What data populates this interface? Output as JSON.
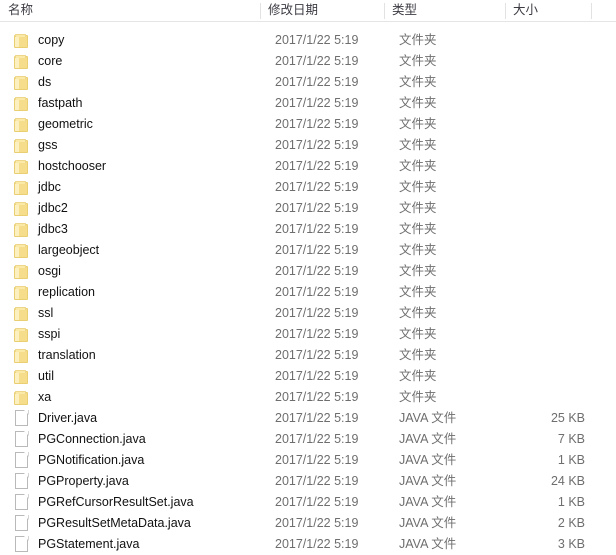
{
  "window": {
    "view": "details",
    "top_artifact": "··"
  },
  "colors": {
    "folder_icon": "#f6dd8c",
    "folder_icon_border": "#e9cf72",
    "file_icon_bg": "#ffffff",
    "file_icon_border": "#b9b9b9",
    "name_text": "#111111",
    "meta_text": "#6e6e6e",
    "header_text": "#3c3c44",
    "header_rule": "#e5e5e5",
    "column_divider": "#e2e2e2",
    "background": "#ffffff"
  },
  "columns": [
    {
      "key": "name",
      "label": "名称"
    },
    {
      "key": "date",
      "label": "修改日期"
    },
    {
      "key": "type",
      "label": "类型"
    },
    {
      "key": "size",
      "label": "大小"
    }
  ],
  "rows": [
    {
      "name": "copy",
      "date": "2017/1/22 5:19",
      "type": "文件夹",
      "size": "",
      "icon": "folder-icon"
    },
    {
      "name": "core",
      "date": "2017/1/22 5:19",
      "type": "文件夹",
      "size": "",
      "icon": "folder-icon"
    },
    {
      "name": "ds",
      "date": "2017/1/22 5:19",
      "type": "文件夹",
      "size": "",
      "icon": "folder-icon"
    },
    {
      "name": "fastpath",
      "date": "2017/1/22 5:19",
      "type": "文件夹",
      "size": "",
      "icon": "folder-icon"
    },
    {
      "name": "geometric",
      "date": "2017/1/22 5:19",
      "type": "文件夹",
      "size": "",
      "icon": "folder-icon"
    },
    {
      "name": "gss",
      "date": "2017/1/22 5:19",
      "type": "文件夹",
      "size": "",
      "icon": "folder-icon"
    },
    {
      "name": "hostchooser",
      "date": "2017/1/22 5:19",
      "type": "文件夹",
      "size": "",
      "icon": "folder-icon"
    },
    {
      "name": "jdbc",
      "date": "2017/1/22 5:19",
      "type": "文件夹",
      "size": "",
      "icon": "folder-icon"
    },
    {
      "name": "jdbc2",
      "date": "2017/1/22 5:19",
      "type": "文件夹",
      "size": "",
      "icon": "folder-icon"
    },
    {
      "name": "jdbc3",
      "date": "2017/1/22 5:19",
      "type": "文件夹",
      "size": "",
      "icon": "folder-icon"
    },
    {
      "name": "largeobject",
      "date": "2017/1/22 5:19",
      "type": "文件夹",
      "size": "",
      "icon": "folder-icon"
    },
    {
      "name": "osgi",
      "date": "2017/1/22 5:19",
      "type": "文件夹",
      "size": "",
      "icon": "folder-icon"
    },
    {
      "name": "replication",
      "date": "2017/1/22 5:19",
      "type": "文件夹",
      "size": "",
      "icon": "folder-icon"
    },
    {
      "name": "ssl",
      "date": "2017/1/22 5:19",
      "type": "文件夹",
      "size": "",
      "icon": "folder-icon"
    },
    {
      "name": "sspi",
      "date": "2017/1/22 5:19",
      "type": "文件夹",
      "size": "",
      "icon": "folder-icon"
    },
    {
      "name": "translation",
      "date": "2017/1/22 5:19",
      "type": "文件夹",
      "size": "",
      "icon": "folder-icon"
    },
    {
      "name": "util",
      "date": "2017/1/22 5:19",
      "type": "文件夹",
      "size": "",
      "icon": "folder-icon"
    },
    {
      "name": "xa",
      "date": "2017/1/22 5:19",
      "type": "文件夹",
      "size": "",
      "icon": "folder-icon"
    },
    {
      "name": "Driver.java",
      "date": "2017/1/22 5:19",
      "type": "JAVA 文件",
      "size": "25 KB",
      "icon": "file-icon"
    },
    {
      "name": "PGConnection.java",
      "date": "2017/1/22 5:19",
      "type": "JAVA 文件",
      "size": "7 KB",
      "icon": "file-icon"
    },
    {
      "name": "PGNotification.java",
      "date": "2017/1/22 5:19",
      "type": "JAVA 文件",
      "size": "1 KB",
      "icon": "file-icon"
    },
    {
      "name": "PGProperty.java",
      "date": "2017/1/22 5:19",
      "type": "JAVA 文件",
      "size": "24 KB",
      "icon": "file-icon"
    },
    {
      "name": "PGRefCursorResultSet.java",
      "date": "2017/1/22 5:19",
      "type": "JAVA 文件",
      "size": "1 KB",
      "icon": "file-icon"
    },
    {
      "name": "PGResultSetMetaData.java",
      "date": "2017/1/22 5:19",
      "type": "JAVA 文件",
      "size": "2 KB",
      "icon": "file-icon"
    },
    {
      "name": "PGStatement.java",
      "date": "2017/1/22 5:19",
      "type": "JAVA 文件",
      "size": "3 KB",
      "icon": "file-icon"
    }
  ]
}
